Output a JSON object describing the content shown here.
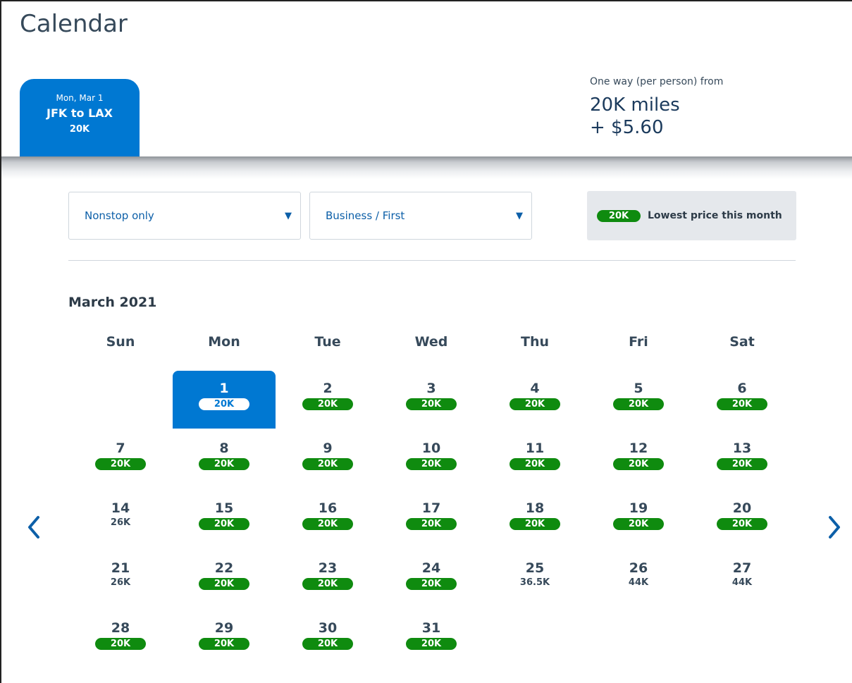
{
  "page": {
    "title": "Calendar"
  },
  "trip_tab": {
    "date": "Mon, Mar 1",
    "route": "JFK to LAX",
    "price": "20K"
  },
  "fare": {
    "label": "One way (per person) from",
    "miles": "20K miles",
    "fees": "+ $5.60"
  },
  "filters": {
    "stops": {
      "value": "Nonstop only"
    },
    "cabin": {
      "value": "Business / First"
    }
  },
  "legend": {
    "pill": "20K",
    "text": "Lowest price this month"
  },
  "calendar": {
    "month": "March 2021",
    "weekdays": [
      "Sun",
      "Mon",
      "Tue",
      "Wed",
      "Thu",
      "Fri",
      "Sat"
    ],
    "selected_day": "1",
    "days": [
      {
        "day": "1",
        "price": "20K",
        "lowest": true
      },
      {
        "day": "2",
        "price": "20K",
        "lowest": true
      },
      {
        "day": "3",
        "price": "20K",
        "lowest": true
      },
      {
        "day": "4",
        "price": "20K",
        "lowest": true
      },
      {
        "day": "5",
        "price": "20K",
        "lowest": true
      },
      {
        "day": "6",
        "price": "20K",
        "lowest": true
      },
      {
        "day": "7",
        "price": "20K",
        "lowest": true
      },
      {
        "day": "8",
        "price": "20K",
        "lowest": true
      },
      {
        "day": "9",
        "price": "20K",
        "lowest": true
      },
      {
        "day": "10",
        "price": "20K",
        "lowest": true
      },
      {
        "day": "11",
        "price": "20K",
        "lowest": true
      },
      {
        "day": "12",
        "price": "20K",
        "lowest": true
      },
      {
        "day": "13",
        "price": "20K",
        "lowest": true
      },
      {
        "day": "14",
        "price": "26K",
        "lowest": false
      },
      {
        "day": "15",
        "price": "20K",
        "lowest": true
      },
      {
        "day": "16",
        "price": "20K",
        "lowest": true
      },
      {
        "day": "17",
        "price": "20K",
        "lowest": true
      },
      {
        "day": "18",
        "price": "20K",
        "lowest": true
      },
      {
        "day": "19",
        "price": "20K",
        "lowest": true
      },
      {
        "day": "20",
        "price": "20K",
        "lowest": true
      },
      {
        "day": "21",
        "price": "26K",
        "lowest": false
      },
      {
        "day": "22",
        "price": "20K",
        "lowest": true
      },
      {
        "day": "23",
        "price": "20K",
        "lowest": true
      },
      {
        "day": "24",
        "price": "20K",
        "lowest": true
      },
      {
        "day": "25",
        "price": "36.5K",
        "lowest": false
      },
      {
        "day": "26",
        "price": "44K",
        "lowest": false
      },
      {
        "day": "27",
        "price": "44K",
        "lowest": false
      },
      {
        "day": "28",
        "price": "20K",
        "lowest": true
      },
      {
        "day": "29",
        "price": "20K",
        "lowest": true
      },
      {
        "day": "30",
        "price": "20K",
        "lowest": true
      },
      {
        "day": "31",
        "price": "20K",
        "lowest": true
      }
    ]
  },
  "colors": {
    "brand_blue": "#0078d2",
    "lowest_green": "#0f8b0f",
    "text_dark": "#36495a"
  },
  "icons": {
    "prev": "chevron-left-icon",
    "next": "chevron-right-icon",
    "dropdown": "caret-down-icon"
  }
}
